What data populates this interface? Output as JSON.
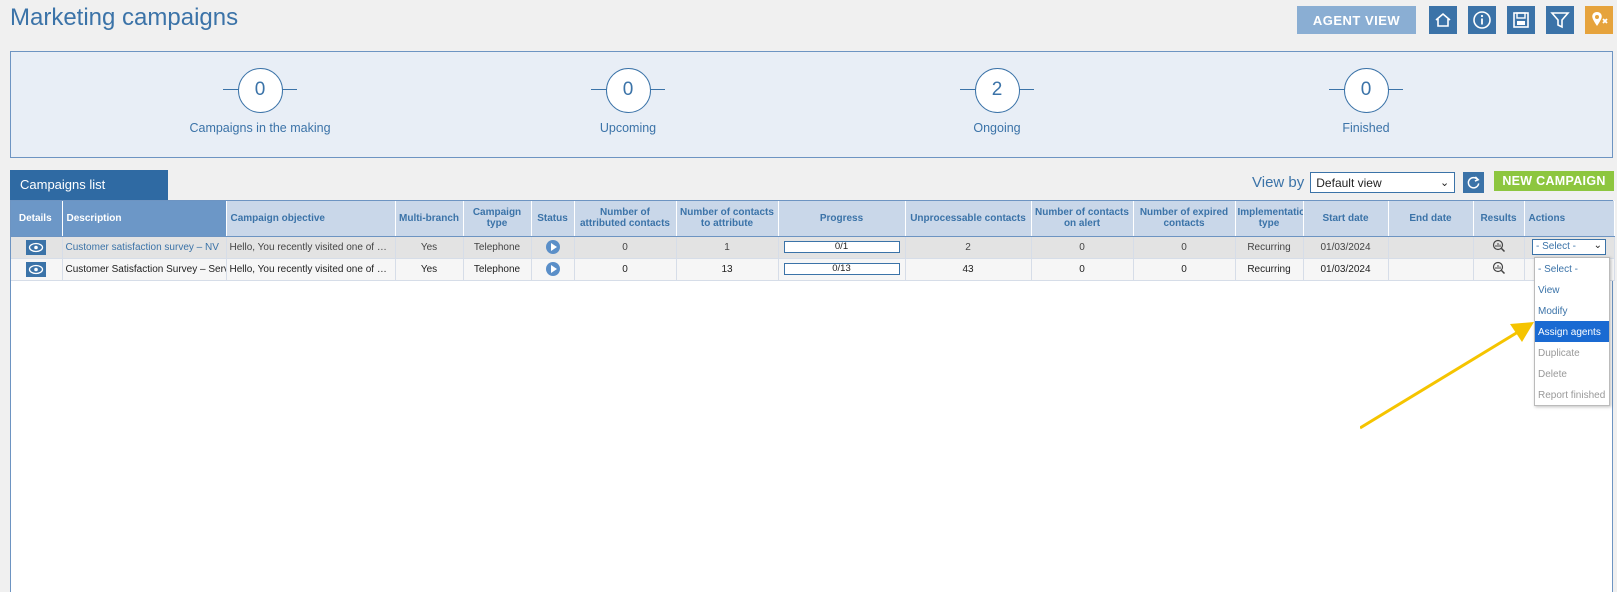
{
  "header": {
    "title": "Marketing campaigns",
    "agent_view_label": "AGENT VIEW"
  },
  "toolbar_icons": [
    "export-icon",
    "info-icon",
    "save-icon",
    "filter-icon",
    "map-pin-icon"
  ],
  "summary": [
    {
      "value": "0",
      "label": "Campaigns in the making"
    },
    {
      "value": "0",
      "label": "Upcoming"
    },
    {
      "value": "2",
      "label": "Ongoing"
    },
    {
      "value": "0",
      "label": "Finished"
    }
  ],
  "list_tab_label": "Campaigns list",
  "view_by": {
    "label": "View by",
    "selected": "Default view"
  },
  "new_campaign_label": "NEW CAMPAIGN",
  "table": {
    "headers": {
      "details": "Details",
      "description": "Description",
      "objective": "Campaign objective",
      "multibranch": "Multi-branch",
      "type": "Campaign type",
      "status": "Status",
      "attributed": "Number of attributed contacts",
      "to_attribute": "Number of contacts to attribute",
      "progress": "Progress",
      "unprocessable": "Unprocessable contacts",
      "on_alert": "Number of contacts on alert",
      "expired": "Number of expired contacts",
      "implementation": "Implementation type",
      "start_date": "Start date",
      "end_date": "End date",
      "results": "Results",
      "actions": "Actions"
    },
    "rows": [
      {
        "description": "Customer satisfaction survey – NV",
        "objective": "Hello, You recently visited one of ou...",
        "multibranch": "Yes",
        "type": "Telephone",
        "attributed": "0",
        "to_attribute": "1",
        "progress_text": "0/1",
        "progress_fraction": 0,
        "unprocessable": "2",
        "on_alert": "0",
        "expired": "0",
        "implementation": "Recurring",
        "start_date": "01/03/2024",
        "end_date": "",
        "action_selected": "- Select -"
      },
      {
        "description": "Customer Satisfaction Survey – Servic",
        "objective": "Hello, You recently visited one of ou...",
        "multibranch": "Yes",
        "type": "Telephone",
        "attributed": "0",
        "to_attribute": "13",
        "progress_text": "0/13",
        "progress_fraction": 0,
        "unprocessable": "43",
        "on_alert": "0",
        "expired": "0",
        "implementation": "Recurring",
        "start_date": "01/03/2024",
        "end_date": "",
        "action_selected": ""
      }
    ]
  },
  "actions_dropdown": {
    "options": [
      {
        "label": "- Select -",
        "state": "normal"
      },
      {
        "label": "View",
        "state": "normal"
      },
      {
        "label": "Modify",
        "state": "normal"
      },
      {
        "label": "Assign agents",
        "state": "highlighted"
      },
      {
        "label": "Duplicate",
        "state": "disabled"
      },
      {
        "label": "Delete",
        "state": "disabled"
      },
      {
        "label": "Report finished",
        "state": "disabled"
      }
    ]
  },
  "colors": {
    "primary": "#3b73a8",
    "accent_green": "#8dc63f",
    "accent_orange": "#e6a33c",
    "highlight": "#1a6ad2",
    "annotation_arrow": "#f5c400"
  }
}
